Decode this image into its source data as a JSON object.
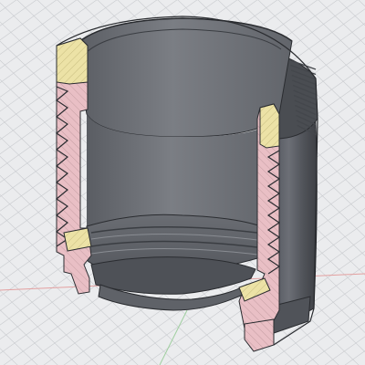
{
  "viewport": {
    "background": "#ebecee",
    "grid_color": "#c9cbcf",
    "axis_x_color": "#e3a0a0",
    "axis_y_color": "#9fcf9f",
    "model": {
      "body_color": "#5d6066",
      "inner_wall_color": "#777a80",
      "section_color_inner": "#ece2a6",
      "section_color_outer": "#e9bfc5",
      "section_hatch_color": "#c69fa4",
      "edge_color": "#2a2c30",
      "knurl_color": "#44474c"
    }
  }
}
